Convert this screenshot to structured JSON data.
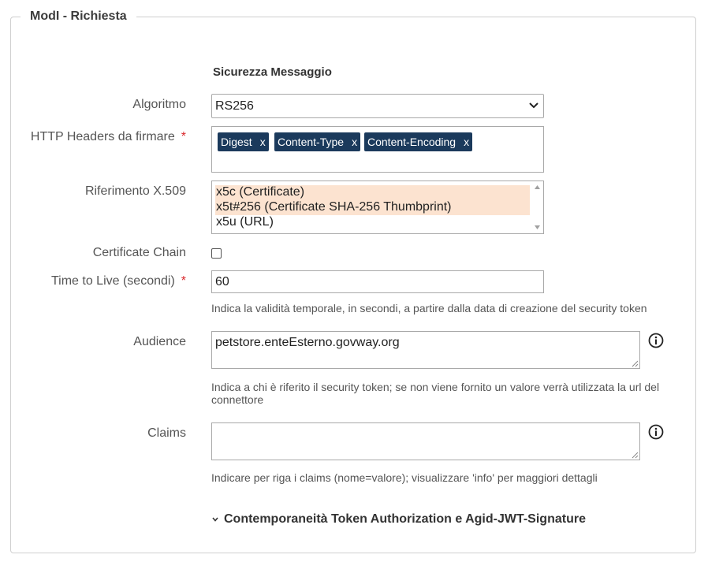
{
  "legend": "ModI - Richiesta",
  "section_title": "Sicurezza Messaggio",
  "algoritmo": {
    "label": "Algoritmo",
    "value": "RS256"
  },
  "http_headers": {
    "label": "HTTP Headers da firmare",
    "required": "*",
    "tags": [
      "Digest",
      "Content-Type",
      "Content-Encoding"
    ],
    "remove": "x"
  },
  "riferimento": {
    "label": "Riferimento X.509",
    "options": [
      {
        "text": "x5c (Certificate)",
        "selected": true
      },
      {
        "text": "x5t#256 (Certificate SHA-256 Thumbprint)",
        "selected": true
      },
      {
        "text": "x5u (URL)",
        "selected": false
      }
    ]
  },
  "certificate_chain": {
    "label": "Certificate Chain",
    "checked": false
  },
  "ttl": {
    "label": "Time to Live (secondi)",
    "required": "*",
    "value": "60",
    "help": "Indica la validità temporale, in secondi, a partire dalla data di creazione del security token"
  },
  "audience": {
    "label": "Audience",
    "value": "petstore.enteEsterno.govway.org",
    "help": "Indica a chi è riferito il security token; se non viene fornito un valore verrà utilizzata la url del connettore",
    "icon": "info-icon"
  },
  "claims": {
    "label": "Claims",
    "value": "",
    "help": "Indicare per riga i claims (nome=valore); visualizzare 'info' per maggiori dettagli",
    "icon": "info-icon"
  },
  "expander": {
    "label": "Contemporaneità Token Authorization e Agid-JWT-Signature",
    "icon": "chevron-down-icon"
  },
  "colors": {
    "tag_bg": "#1b3a5c",
    "selected_option_bg": "#fce3d0",
    "required": "#d9262a"
  }
}
